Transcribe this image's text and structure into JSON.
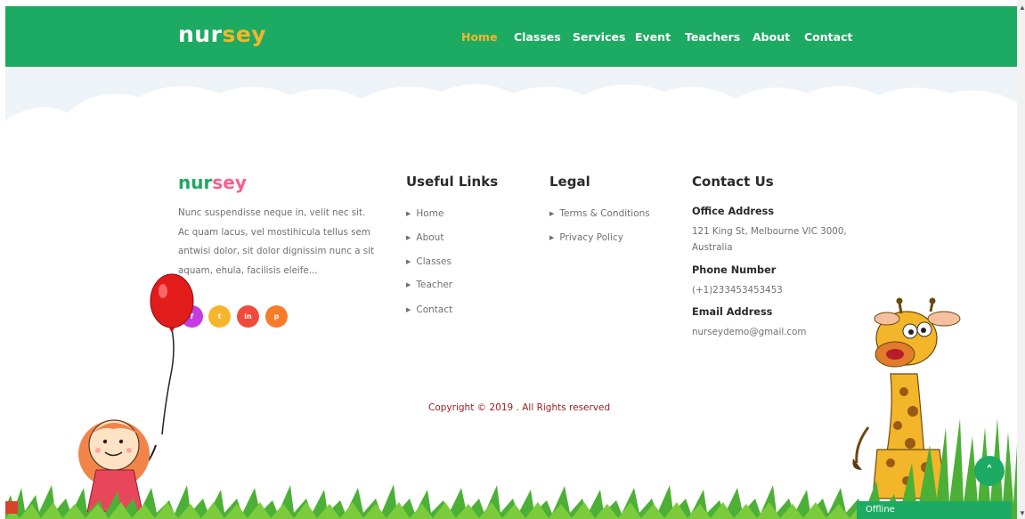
{
  "header": {
    "logo_part1": "nur",
    "logo_part2": "sey",
    "nav": [
      "Home",
      "Classes",
      "Services",
      "Event",
      "Teachers",
      "About",
      "Contact"
    ],
    "active_nav": "Home"
  },
  "footer": {
    "about": {
      "logo_part1": "nur",
      "logo_part2": "sey",
      "text": "Nunc suspendisse neque in, velit nec sit. Ac quam lacus, vel mostihicula tellus sem antwisi dolor, sit dolor dignissim nunc a sit aquam, ehula, facilisis eleife...",
      "social": [
        {
          "label": "f",
          "icon": "facebook-icon",
          "color": "#c53ce0"
        },
        {
          "label": "t",
          "icon": "twitter-icon",
          "color": "#f7b52c"
        },
        {
          "label": "in",
          "icon": "linkedin-icon",
          "color": "#ef4a3b"
        },
        {
          "label": "p",
          "icon": "pinterest-icon",
          "color": "#f77c2a"
        }
      ]
    },
    "useful_links": {
      "title": "Useful Links",
      "items": [
        "Home",
        "About",
        "Classes",
        "Teacher",
        "Contact"
      ]
    },
    "legal": {
      "title": "Legal",
      "items": [
        "Terms & Conditions",
        "Privacy Policy"
      ]
    },
    "contact": {
      "title": "Contact Us",
      "office_label": "Office Address",
      "office_line1": "121 King St, Melbourne VIC 3000,",
      "office_line2": "Australia",
      "phone_label": "Phone Number",
      "phone": "(+1)233453453453",
      "email_label": "Email Address",
      "email": "nurseydemo@gmail.com"
    },
    "copyright": "Copyright © 2019 . All Rights reserved"
  },
  "widgets": {
    "scroll_top_icon": "double-chevron-up-icon",
    "chat_status": "Offline"
  },
  "colors": {
    "brand_green": "#1daa62",
    "brand_yellow": "#f7b52c",
    "brand_pink": "#ff5c8a",
    "copyright_red": "#9b1c1c"
  }
}
